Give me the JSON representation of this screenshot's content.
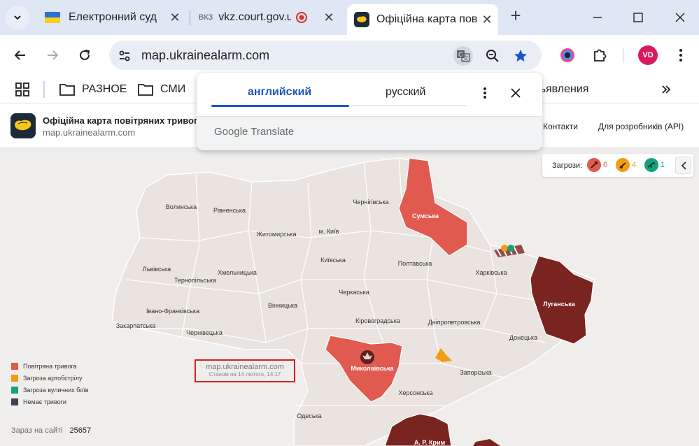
{
  "browser": {
    "tabs": [
      {
        "title": "Електронний суд"
      },
      {
        "title": "vkz.court.gov.ua",
        "favicon_text": "ВКЗ"
      },
      {
        "title": "Офіційна карта пов"
      }
    ],
    "url": "map.ukrainealarm.com",
    "profile_initials": "VD"
  },
  "bookmarks": [
    {
      "label": "РАЗНОЕ"
    },
    {
      "label": "СМИ"
    },
    {
      "label": "ъявления"
    }
  ],
  "translate_popup": {
    "tab_english": "английский",
    "tab_russian": "русский",
    "brand": "Google Translate"
  },
  "site": {
    "title": "Офіційна карта повітряних тривог Укр",
    "domain": "map.ukrainealarm.com",
    "nav": [
      "Контакти",
      "Для розробників (API)"
    ]
  },
  "threats": {
    "label": "Загрози:",
    "items": [
      {
        "icon": "rocket-icon",
        "count": "6",
        "color": "#e05a50"
      },
      {
        "icon": "artillery-icon",
        "count": "4",
        "color": "#f39c12"
      },
      {
        "icon": "gun-icon",
        "count": "1",
        "color": "#16a07b"
      }
    ]
  },
  "legend": [
    {
      "label": "Повітряна тривога",
      "color": "#e05a50"
    },
    {
      "label": "Загроза артобстрілу",
      "color": "#f39c12"
    },
    {
      "label": "Загроза вуличних боїв",
      "color": "#16a07b"
    },
    {
      "label": "Немає тривоги",
      "color": "#3b4350"
    }
  ],
  "stamp": {
    "domain": "map.ukrainealarm.com",
    "as_of": "Станом на 14 лютого, 14:17"
  },
  "online": {
    "label": "Зараз на сайті",
    "count": "25657"
  },
  "map_labels": {
    "volyn": "Волинська",
    "rivne": "Рівненська",
    "zhytomyr": "Житомирська",
    "kyiv_city": "м. Київ",
    "chernihiv": "Чернігівська",
    "sumy": "Сумська",
    "lviv": "Львівська",
    "ternopil": "Тернопільська",
    "khmelnytskyi": "Хмельницька",
    "kyiv": "Київська",
    "poltava": "Полтавська",
    "kharkiv": "Харківська",
    "luhansk": "Луганська",
    "ivano_frankivsk": "Івано-Франківська",
    "vinnytsia": "Вінницька",
    "cherkasy": "Черкаська",
    "zakarpattia": "Закарпатська",
    "chernivtsi": "Чернівецька",
    "kirovohrad": "Кіровоградська",
    "dnipropetrovsk": "Дніпропетровська",
    "donetsk": "Донецька",
    "mykolaiv": "Миколаївська",
    "zaporizhzhia": "Запорізька",
    "kherson": "Херсонська",
    "odesa": "Одеська",
    "crimea": "А. Р. Крим"
  },
  "colors": {
    "alert": "#e05a50",
    "occupied": "#7a2420",
    "region_fill": "#e9e4df",
    "accent_blue": "#1a56c4"
  }
}
